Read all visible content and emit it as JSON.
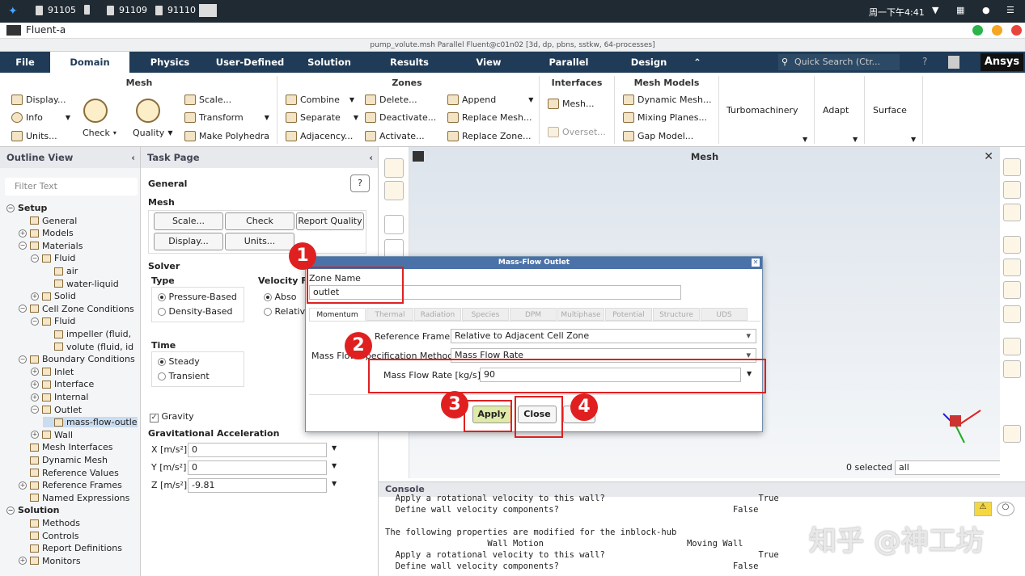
{
  "os": {
    "tasks": [
      "91105",
      "91109",
      "91110"
    ],
    "clock": "周一下午4:41"
  },
  "window": {
    "app_title": "Fluent-a"
  },
  "fluent_title": "pump_volute.msh Parallel Fluent@c01n02  [3d, dp, pbns, sstkw, 64-processes]",
  "tabs": [
    "File",
    "Domain",
    "Physics",
    "User-Defined",
    "Solution",
    "Results",
    "View",
    "Parallel",
    "Design"
  ],
  "active_tab": "Domain",
  "quick_search": "Quick Search (Ctr...",
  "brand": "Ansys",
  "ribbon": {
    "mesh": {
      "title": "Mesh",
      "display": "Display...",
      "info": "Info",
      "units": "Units...",
      "check": "Check",
      "quality": "Quality",
      "scale": "Scale...",
      "transform": "Transform",
      "polyhedra": "Make Polyhedra"
    },
    "zones": {
      "title": "Zones",
      "combine": "Combine",
      "separate": "Separate",
      "adjacency": "Adjacency...",
      "delete": "Delete...",
      "deactivate": "Deactivate...",
      "activate": "Activate...",
      "append": "Append",
      "replace_mesh": "Replace Mesh...",
      "replace_zone": "Replace Zone..."
    },
    "interfaces": {
      "title": "Interfaces",
      "mesh": "Mesh...",
      "overset": "Overset..."
    },
    "mesh_models": {
      "title": "Mesh Models",
      "dynamic": "Dynamic Mesh...",
      "mixing": "Mixing Planes...",
      "gap": "Gap Model..."
    },
    "turbomachinery": "Turbomachinery",
    "adapt": "Adapt",
    "surface": "Surface"
  },
  "outline": {
    "title": "Outline View",
    "filter": "Filter Text",
    "nodes": [
      "Setup",
      "General",
      "Models",
      "Materials",
      "Fluid",
      "air",
      "water-liquid",
      "Solid",
      "Cell Zone Conditions",
      "Fluid",
      "impeller (fluid,",
      "volute (fluid, id",
      "Boundary Conditions",
      "Inlet",
      "Interface",
      "Internal",
      "Outlet",
      "mass-flow-outle",
      "Wall",
      "Mesh Interfaces",
      "Dynamic Mesh",
      "Reference Values",
      "Reference Frames",
      "Named Expressions",
      "Solution",
      "Methods",
      "Controls",
      "Report Definitions",
      "Monitors"
    ]
  },
  "task": {
    "title": "Task Page",
    "general": "General",
    "help": "?",
    "mesh": "Mesh",
    "scale": "Scale...",
    "check": "Check",
    "report_quality": "Report Quality",
    "display": "Display...",
    "units": "Units...",
    "solver": "Solver",
    "type": "Type",
    "pressure": "Pressure-Based",
    "density": "Density-Based",
    "velocity": "Velocity F",
    "abso": "Abso",
    "relativ": "Relativ",
    "time": "Time",
    "steady": "Steady",
    "transient": "Transient",
    "gravity": "Gravity",
    "grav_acc": "Gravitational Acceleration",
    "x_label": "X [m/s²]",
    "x_val": "0",
    "y_label": "Y [m/s²]",
    "y_val": "0",
    "z_label": "Z [m/s²]",
    "z_val": "-9.81"
  },
  "graphics": {
    "title": "Mesh",
    "selected": "0 selected",
    "filter": "all"
  },
  "console": {
    "title": "Console",
    "lines": [
      "  Apply a rotational velocity to this wall?                              True",
      "  Define wall velocity components?                                  False",
      "",
      "The following properties are modified for the inblock-hub",
      "                    Wall Motion                            Moving Wall",
      "  Apply a rotational velocity to this wall?                              True",
      "  Define wall velocity components?                                  False"
    ]
  },
  "dialog": {
    "title": "Mass-Flow Outlet",
    "zone_label": "Zone Name",
    "zone_value": "outlet",
    "tabs": [
      "Momentum",
      "Thermal",
      "Radiation",
      "Species",
      "DPM",
      "Multiphase",
      "Potential",
      "Structure",
      "UDS"
    ],
    "ref_frame_label": "Reference Frame",
    "ref_frame_value": "Relative to Adjacent Cell Zone",
    "spec_label": "Mass Flow Specification Method",
    "spec_value": "Mass Flow Rate",
    "rate_label": "Mass Flow Rate [kg/s]",
    "rate_value": "90",
    "apply": "Apply",
    "close": "Close"
  },
  "annotations": [
    "1",
    "2",
    "3",
    "4"
  ],
  "watermark": "知乎 @神工坊",
  "colors": {
    "tab_bar": "#1f3b57",
    "annotation_red": "#e02020",
    "dialog_header": "#4a72a8"
  }
}
